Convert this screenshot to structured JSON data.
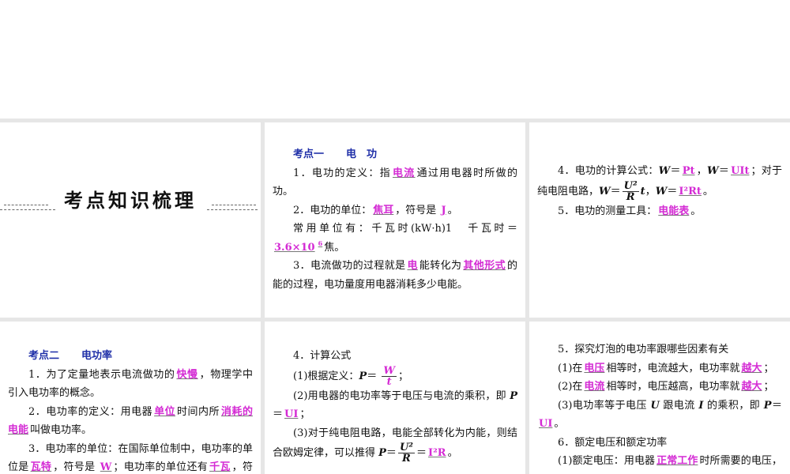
{
  "title": "考点知识梳理",
  "panels": [
    {
      "id": "p1",
      "paras": [
        {
          "h": [
            "考点一",
            "电　功"
          ]
        },
        {
          "s": [
            [
              "t",
              "1．电功的定义：指"
            ],
            [
              "b",
              "电流"
            ],
            [
              "t",
              "通过用电器时所做的功。"
            ]
          ]
        },
        {
          "s": [
            [
              "t",
              "2．电功的单位："
            ],
            [
              "b",
              "焦耳"
            ],
            [
              "t",
              "，符号是 "
            ],
            [
              "b",
              "J"
            ],
            [
              "t",
              "。"
            ]
          ]
        },
        {
          "s": [
            [
              "t",
              "常用单位有：千瓦时(kW·h)1　千瓦时＝"
            ],
            [
              "b",
              "3.6×10"
            ],
            [
              "sup",
              "6"
            ],
            [
              "t",
              "焦。"
            ]
          ]
        },
        {
          "s": [
            [
              "t",
              "3．电流做功的过程就是"
            ],
            [
              "b",
              "电"
            ],
            [
              "t",
              "能转化为"
            ],
            [
              "b",
              "其他形式"
            ],
            [
              "t",
              "的能的过程，电功量度用电器消耗多少电能。"
            ]
          ]
        }
      ]
    },
    {
      "id": "p2",
      "paras": [
        {
          "s": [
            [
              "t",
              "4．电功的计算公式："
            ],
            [
              "i",
              "W"
            ],
            [
              "t",
              "＝"
            ],
            [
              "b",
              "Pt"
            ],
            [
              "t",
              "，"
            ],
            [
              "i",
              "W"
            ],
            [
              "t",
              "＝"
            ],
            [
              "b",
              "UIt"
            ],
            [
              "t",
              "；对于纯电阻电路，"
            ],
            [
              "i",
              "W"
            ],
            [
              "t",
              "＝"
            ],
            [
              "frac",
              "U²",
              "R",
              "b"
            ],
            [
              "i",
              "t"
            ],
            [
              "t",
              "，"
            ],
            [
              "i",
              "W"
            ],
            [
              "t",
              "＝"
            ],
            [
              "b",
              "I²Rt"
            ],
            [
              "t",
              "。"
            ]
          ]
        },
        {
          "s": [
            [
              "t",
              "5．电功的测量工具："
            ],
            [
              "b",
              "电能表"
            ],
            [
              "t",
              "。"
            ]
          ]
        }
      ]
    },
    {
      "id": "p3",
      "paras": [
        {
          "h": [
            "考点二",
            "电功率"
          ]
        },
        {
          "s": [
            [
              "t",
              "1．为了定量地表示电流做功的"
            ],
            [
              "b",
              "快慢"
            ],
            [
              "t",
              "，物理学中引入电功率的概念。"
            ]
          ]
        },
        {
          "s": [
            [
              "t",
              "2．电功率的定义：用电器"
            ],
            [
              "b",
              "单位"
            ],
            [
              "t",
              "时间内所"
            ],
            [
              "b",
              "消耗的电能"
            ],
            [
              "t",
              "叫做电功率。"
            ]
          ]
        },
        {
          "s": [
            [
              "t",
              "3．电功率的单位：在国际单位制中，电功率的单位是"
            ],
            [
              "b",
              "瓦特"
            ],
            [
              "t",
              "，符号是 "
            ],
            [
              "b",
              "W"
            ],
            [
              "t",
              "；电功率的单位还有"
            ],
            [
              "b",
              "千瓦"
            ],
            [
              "t",
              "，符号"
            ]
          ]
        }
      ]
    },
    {
      "id": "p4",
      "paras": [
        {
          "s": [
            [
              "t",
              "4．计算公式"
            ]
          ]
        },
        {
          "s": [
            [
              "t",
              "(1)根据定义："
            ],
            [
              "i",
              "P"
            ],
            [
              "t",
              "＝ "
            ],
            [
              "frac",
              "W",
              "t",
              "c"
            ],
            [
              "t",
              "；"
            ]
          ]
        },
        {
          "s": [
            [
              "t",
              "(2)用电器的电功率等于电压与电流的乘积，即 "
            ],
            [
              "i",
              "P"
            ],
            [
              "t",
              "＝"
            ],
            [
              "b",
              "UI"
            ],
            [
              "t",
              "；"
            ]
          ]
        },
        {
          "s": [
            [
              "t",
              "(3)对于纯电阻电路，电能全部转化为内能，则结合欧姆定律，可以推得 "
            ],
            [
              "i",
              "P"
            ],
            [
              "t",
              "＝"
            ],
            [
              "frac",
              "U²",
              "R",
              "n"
            ],
            [
              "t",
              "＝"
            ],
            [
              "b",
              "I²R"
            ],
            [
              "t",
              "。"
            ]
          ]
        }
      ]
    },
    {
      "id": "p5",
      "paras": [
        {
          "s": [
            [
              "t",
              "5．探究灯泡的电功率跟哪些因素有关"
            ]
          ]
        },
        {
          "s": [
            [
              "t",
              "(1)在"
            ],
            [
              "b",
              "电压"
            ],
            [
              "t",
              "相等时，电流越大，电功率就"
            ],
            [
              "b",
              "越大"
            ],
            [
              "t",
              "；"
            ]
          ]
        },
        {
          "s": [
            [
              "t",
              "(2)在"
            ],
            [
              "b",
              "电流"
            ],
            [
              "t",
              "相等时，电压越高，电功率就"
            ],
            [
              "b",
              "越大"
            ],
            [
              "t",
              "；"
            ]
          ]
        },
        {
          "s": [
            [
              "t",
              "(3)电功率等于电压 "
            ],
            [
              "i",
              "U"
            ],
            [
              "t",
              " 跟电流 "
            ],
            [
              "i",
              "I"
            ],
            [
              "t",
              " 的乘积，即 "
            ],
            [
              "i",
              "P"
            ],
            [
              "t",
              "＝"
            ],
            [
              "b",
              "UI"
            ],
            [
              "t",
              "。"
            ]
          ]
        },
        {
          "s": [
            [
              "t",
              "6．额定电压和额定功率"
            ]
          ]
        },
        {
          "s": [
            [
              "t",
              "(1)额定电压：用电器"
            ],
            [
              "b",
              "正常工作"
            ],
            [
              "t",
              "时所需要的电压，叫做额定电压。"
            ]
          ]
        }
      ]
    }
  ]
}
